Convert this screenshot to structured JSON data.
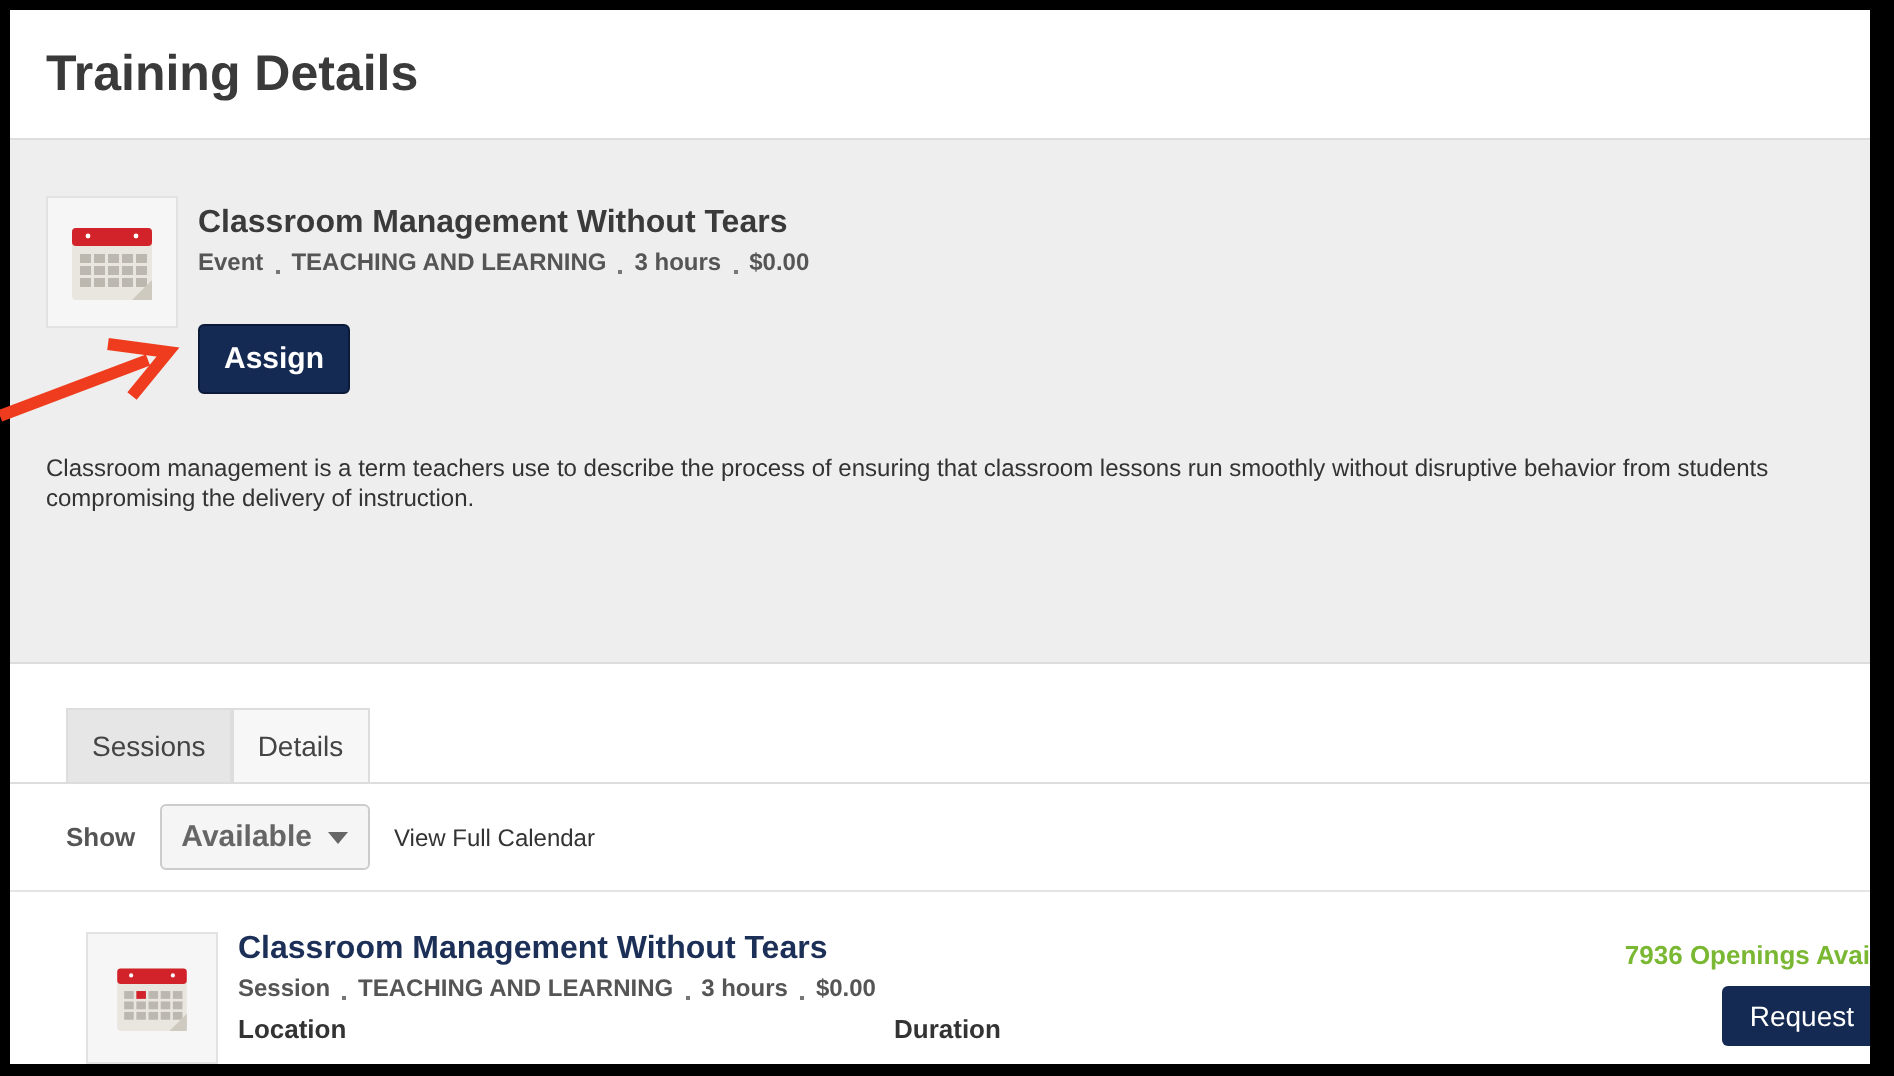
{
  "page": {
    "title": "Training Details"
  },
  "training": {
    "title": "Classroom Management Without Tears",
    "meta": [
      "Event",
      "TEACHING AND LEARNING",
      "3 hours",
      "$0.00"
    ],
    "assign_button": "Assign",
    "description": "Classroom management is a term teachers use to describe the process of ensuring that classroom lessons run smoothly without disruptive behavior from students compromising the delivery of instruction."
  },
  "tabs": [
    {
      "label": "Sessions",
      "selected": true
    },
    {
      "label": "Details",
      "selected": false
    }
  ],
  "filter": {
    "label": "Show",
    "value": "Available",
    "link": "View Full Calendar"
  },
  "session": {
    "title": "Classroom Management Without Tears",
    "meta": [
      "Session",
      "TEACHING AND LEARNING",
      "3 hours",
      "$0.00"
    ],
    "openings": "7936 Openings Avai",
    "request_button": "Request",
    "column_1": "Location",
    "column_2": "Duration"
  }
}
